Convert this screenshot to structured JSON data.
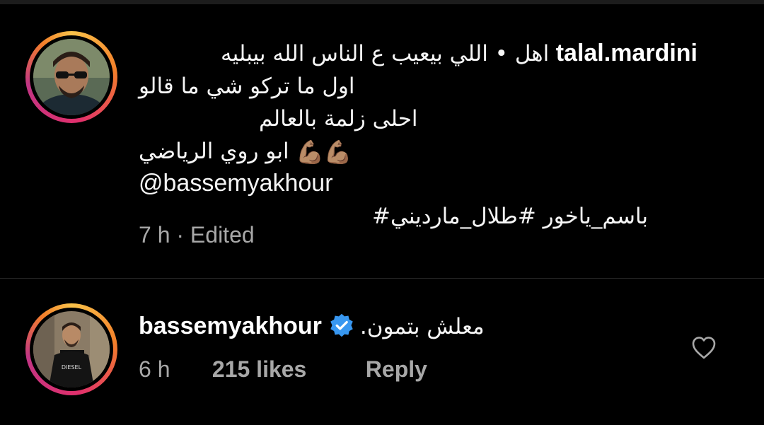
{
  "post": {
    "username": "talal.mardini",
    "lines": [
      "اهل • اللي بيعيب ع الناس الله بيبليه",
      "اول ما تركو شي ما قالو",
      "احلى زلمة بالعالم",
      "ابو روي الرياضي",
      "@bassemyakhour",
      "#باسم_ياخور #طلال_مارديني"
    ],
    "muscle_emoji": "💪🏽💪🏽",
    "meta": "7 h · Edited"
  },
  "comment": {
    "username": "bassemyakhour",
    "text": ".معلش بتمون",
    "time": "6 h",
    "likes": "215 likes",
    "reply": "Reply",
    "verified": true
  },
  "icons": {
    "verified": "verified-badge-icon",
    "like": "heart-outline-icon"
  },
  "colors": {
    "background": "#000000",
    "text": "#f5f5f5",
    "muted": "#a8a8a8",
    "verified": "#3897f0"
  }
}
